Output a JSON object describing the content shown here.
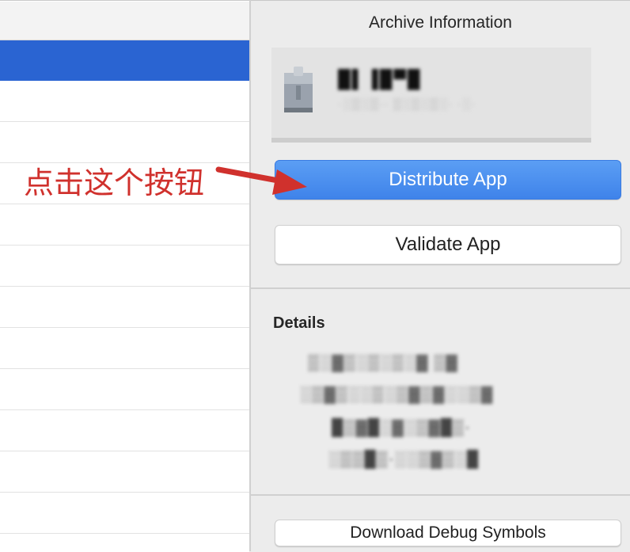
{
  "left_pane": {
    "selected_row_index": 0
  },
  "inspector": {
    "title": "Archive Information",
    "archive": {
      "icon": "archive-icon",
      "name": "█▌▐█▀█",
      "meta": "·░▒░▒·· ▒░▒░▒░· ·░·"
    },
    "distribute_button": "Distribute App",
    "validate_button": "Validate App",
    "details_label": "Details",
    "details_lines": [
      "▒░▓▒░▒░▒░▓ ▒▓",
      "░▒▓▒░░▒░▒▓▒▓░░▒▓",
      "█▒▓█░▓░▒▓█▒·",
      "░▒▒█▒·░░▒▓▒░█"
    ],
    "download_button": "Download Debug Symbols"
  },
  "annotation": {
    "text": "点击这个按钮",
    "color": "#d0312d"
  },
  "colors": {
    "selection": "#2a64d2",
    "primary_button": "#4a8ef0"
  }
}
